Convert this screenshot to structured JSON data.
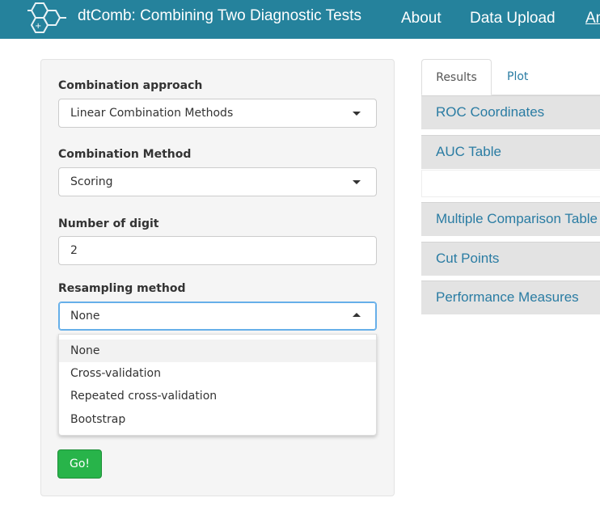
{
  "navbar": {
    "brand": "dtComb: Combining Two Diagnostic Tests",
    "links": [
      "About",
      "Data Upload",
      "An"
    ]
  },
  "form": {
    "approach_label": "Combination approach",
    "approach_value": "Linear Combination Methods",
    "method_label": "Combination Method",
    "method_value": "Scoring",
    "digit_label": "Number of digit",
    "digit_value": "2",
    "resampling_label": "Resampling method",
    "resampling_value": "None",
    "resampling_options": [
      "None",
      "Cross-validation",
      "Repeated cross-validation",
      "Bootstrap"
    ],
    "go_label": "Go!"
  },
  "tabs": [
    "Results",
    "Plot"
  ],
  "accordion": [
    "ROC Coordinates",
    "AUC Table",
    "Multiple Comparison Table",
    "Cut Points",
    "Performance Measures"
  ],
  "colors": {
    "navbar": "#25829c",
    "accent_link": "#2a7ca3",
    "go_button": "#28b44a"
  },
  "icons": {
    "logo": "hexagon-molecule-icon"
  }
}
